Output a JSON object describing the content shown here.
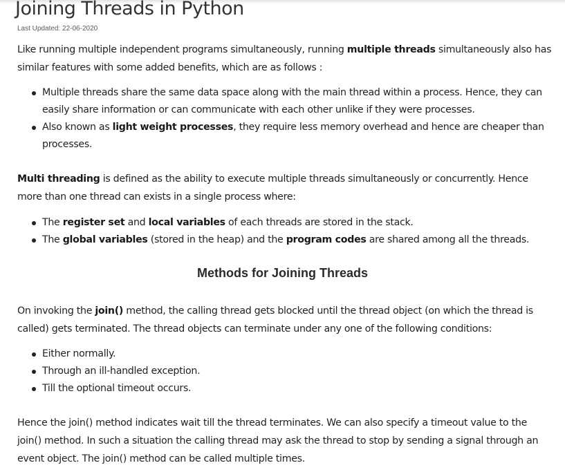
{
  "article": {
    "title": "Joining Threads in Python",
    "last_updated": "Last Updated: 22-06-2020",
    "intro": {
      "part1": "Like running multiple independent programs simultaneously, running ",
      "bold1": "multiple threads",
      "part2": " simultaneously also has similar features with some added benefits, which are as follows :"
    },
    "benefits": [
      {
        "text": "Multiple threads share the same data space along with the main thread within a process. Hence, they can easily share information or can communicate with each other unlike if they were processes."
      },
      {
        "pre": "Also known as ",
        "bold": "light weight processes",
        "post": ", they require less memory overhead and hence are cheaper than processes."
      }
    ],
    "multithreading": {
      "bold": "Multi threading",
      "text": " is defined as the ability to execute multiple threads simultaneously or concurrently. Hence more than one thread can exists in a single process where:"
    },
    "storage": [
      {
        "pre": "The ",
        "bold1": "register set",
        "mid": " and ",
        "bold2": "local variables",
        "post": " of each threads are stored in the stack."
      },
      {
        "pre": "The ",
        "bold1": "global variables",
        "mid": " (stored in the heap) and the ",
        "bold2": "program codes",
        "post": " are shared among all the threads."
      }
    ],
    "methods_heading": "Methods for Joining Threads",
    "join_para": {
      "pre": "On invoking the ",
      "bold": "join()",
      "post": " method, the calling thread gets blocked until the thread object (on which the thread is called) gets terminated. The thread objects can terminate under any one of the following conditions:"
    },
    "conditions": [
      "Either normally.",
      "Through an ill-handled exception.",
      "Till the optional timeout occurs."
    ],
    "closing": "Hence the join() method indicates wait till the thread terminates. We can also specify a timeout value to the join() method. In such a situation the calling thread may ask the thread to stop by sending a signal through an event object. The join() method can be called multiple times."
  }
}
